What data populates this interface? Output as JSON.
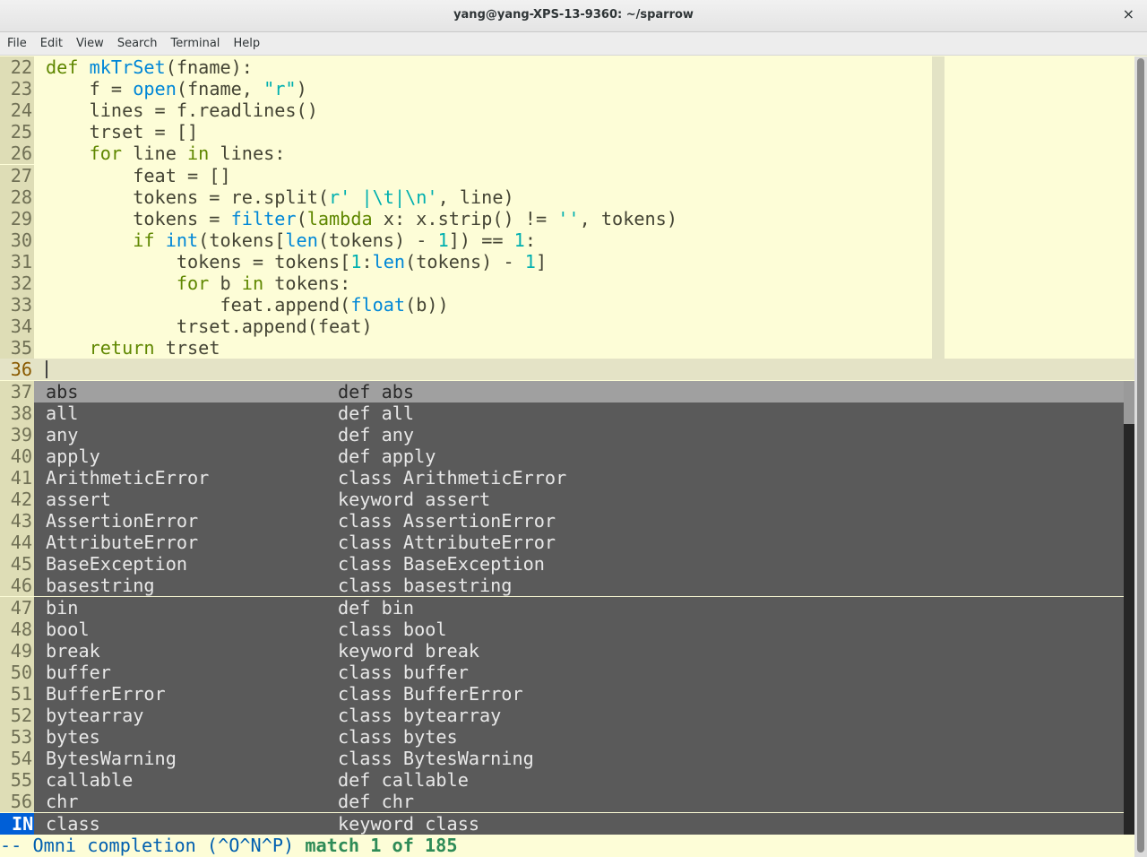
{
  "window": {
    "title": "yang@yang-XPS-13-9360: ~/sparrow",
    "close_glyph": "×"
  },
  "menu": [
    "File",
    "Edit",
    "View",
    "Search",
    "Terminal",
    "Help"
  ],
  "code_lines": [
    {
      "n": "22",
      "tokens": [
        [
          "kw",
          "def"
        ],
        [
          "pn",
          " "
        ],
        [
          "fn",
          "mkTrSet"
        ],
        [
          "pn",
          "(fname):"
        ]
      ]
    },
    {
      "n": "23",
      "tokens": [
        [
          "pn",
          "    f = "
        ],
        [
          "fn",
          "open"
        ],
        [
          "pn",
          "(fname, "
        ],
        [
          "st",
          "\"r\""
        ],
        [
          "pn",
          ")"
        ]
      ]
    },
    {
      "n": "24",
      "tokens": [
        [
          "pn",
          "    lines = f.readlines()"
        ]
      ]
    },
    {
      "n": "25",
      "tokens": [
        [
          "pn",
          "    trset = []"
        ]
      ]
    },
    {
      "n": "26",
      "tokens": [
        [
          "pn",
          "    "
        ],
        [
          "kw",
          "for"
        ],
        [
          "pn",
          " line "
        ],
        [
          "kw",
          "in"
        ],
        [
          "pn",
          " lines:"
        ]
      ]
    },
    {
      "n": "27",
      "tokens": [
        [
          "pn",
          "        feat = []"
        ]
      ]
    },
    {
      "n": "28",
      "tokens": [
        [
          "pn",
          "        tokens = re.split("
        ],
        [
          "st",
          "r' |\\t|\\n'"
        ],
        [
          "pn",
          ", line)"
        ]
      ]
    },
    {
      "n": "29",
      "tokens": [
        [
          "pn",
          "        tokens = "
        ],
        [
          "fn",
          "filter"
        ],
        [
          "pn",
          "("
        ],
        [
          "kw",
          "lambda"
        ],
        [
          "pn",
          " x: x.strip() != "
        ],
        [
          "st",
          "''"
        ],
        [
          "pn",
          ", tokens)"
        ]
      ]
    },
    {
      "n": "30",
      "tokens": [
        [
          "pn",
          "        "
        ],
        [
          "kw",
          "if"
        ],
        [
          "pn",
          " "
        ],
        [
          "fn",
          "int"
        ],
        [
          "pn",
          "(tokens["
        ],
        [
          "fn",
          "len"
        ],
        [
          "pn",
          "(tokens) - "
        ],
        [
          "nu",
          "1"
        ],
        [
          "pn",
          "]) == "
        ],
        [
          "nu",
          "1"
        ],
        [
          "pn",
          ":"
        ]
      ]
    },
    {
      "n": "31",
      "tokens": [
        [
          "pn",
          "            tokens = tokens["
        ],
        [
          "nu",
          "1"
        ],
        [
          "pn",
          ":"
        ],
        [
          "fn",
          "len"
        ],
        [
          "pn",
          "(tokens) - "
        ],
        [
          "nu",
          "1"
        ],
        [
          "pn",
          "]"
        ]
      ]
    },
    {
      "n": "32",
      "tokens": [
        [
          "pn",
          "            "
        ],
        [
          "kw",
          "for"
        ],
        [
          "pn",
          " b "
        ],
        [
          "kw",
          "in"
        ],
        [
          "pn",
          " tokens:"
        ]
      ]
    },
    {
      "n": "33",
      "tokens": [
        [
          "pn",
          "                feat.append("
        ],
        [
          "fn",
          "float"
        ],
        [
          "pn",
          "(b))"
        ]
      ]
    },
    {
      "n": "34",
      "tokens": [
        [
          "pn",
          "            trset.append(feat)"
        ]
      ]
    },
    {
      "n": "35",
      "tokens": [
        [
          "pn",
          "    "
        ],
        [
          "kw",
          "return"
        ],
        [
          "pn",
          " trset"
        ]
      ]
    }
  ],
  "current_line": {
    "n": "36"
  },
  "popup": [
    {
      "n": "37",
      "word": "abs",
      "menu": "def abs"
    },
    {
      "n": "38",
      "word": "all",
      "menu": "def all"
    },
    {
      "n": "39",
      "word": "any",
      "menu": "def any"
    },
    {
      "n": "40",
      "word": "apply",
      "menu": "def apply"
    },
    {
      "n": "41",
      "word": "ArithmeticError",
      "menu": "class ArithmeticError"
    },
    {
      "n": "42",
      "word": "assert",
      "menu": "keyword assert"
    },
    {
      "n": "43",
      "word": "AssertionError",
      "menu": "class AssertionError"
    },
    {
      "n": "44",
      "word": "AttributeError",
      "menu": "class AttributeError"
    },
    {
      "n": "45",
      "word": "BaseException",
      "menu": "class BaseException"
    },
    {
      "n": "46",
      "word": "basestring",
      "menu": "class basestring"
    },
    {
      "n": "47",
      "word": "bin",
      "menu": "def bin"
    },
    {
      "n": "48",
      "word": "bool",
      "menu": "class bool"
    },
    {
      "n": "49",
      "word": "break",
      "menu": "keyword break"
    },
    {
      "n": "50",
      "word": "buffer",
      "menu": "class buffer"
    },
    {
      "n": "51",
      "word": "BufferError",
      "menu": "class BufferError"
    },
    {
      "n": "52",
      "word": "bytearray",
      "menu": "class bytearray"
    },
    {
      "n": "53",
      "word": "bytes",
      "menu": "class bytes"
    },
    {
      "n": "54",
      "word": "BytesWarning",
      "menu": "class BytesWarning"
    },
    {
      "n": "55",
      "word": "callable",
      "menu": "def callable"
    },
    {
      "n": "56",
      "word": "chr",
      "menu": "def chr"
    },
    {
      "n": "IN",
      "word": "class",
      "menu": "keyword class"
    }
  ],
  "popup_selected_index": 0,
  "status": {
    "mode_text": "-- Omni completion (^O^N^P) ",
    "match_text": "match 1 of 185"
  },
  "colors": {
    "keyword": "#5f8700",
    "function": "#0087d7",
    "string": "#00afaf",
    "mode_bg": "#005fd7"
  }
}
